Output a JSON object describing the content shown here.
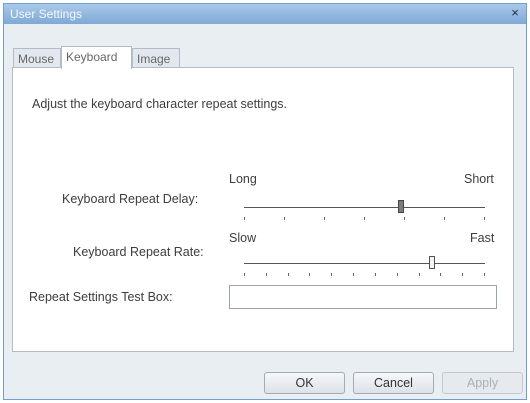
{
  "window": {
    "title": "User Settings",
    "close_glyph": "×"
  },
  "tabs": [
    {
      "label": "Mouse",
      "active": false
    },
    {
      "label": "Keyboard",
      "active": true
    },
    {
      "label": "Image",
      "active": false
    }
  ],
  "description": "Adjust the keyboard character repeat settings.",
  "delay": {
    "label": "Keyboard Repeat Delay:",
    "min_label": "Long",
    "max_label": "Short",
    "value_fraction": 0.65,
    "tick_count": 7
  },
  "rate": {
    "label": "Keyboard Repeat Rate:",
    "min_label": "Slow",
    "max_label": "Fast",
    "value_fraction": 0.78,
    "tick_count": 12
  },
  "test_box": {
    "label": "Repeat Settings Test Box:",
    "value": ""
  },
  "buttons": {
    "ok": "OK",
    "cancel": "Cancel",
    "apply": "Apply"
  }
}
